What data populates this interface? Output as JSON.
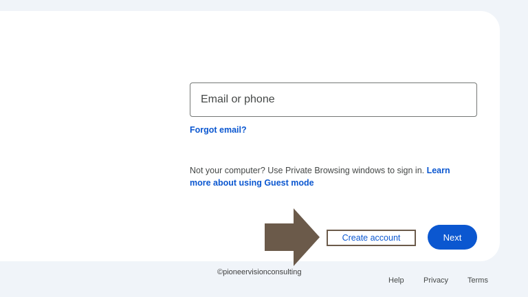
{
  "signin": {
    "email_placeholder": "Email or phone",
    "forgot_email_label": "Forgot email?",
    "guest_notice_text": "Not your computer? Use Private Browsing windows to sign in. ",
    "guest_link_label": "Learn more about using Guest mode",
    "create_account_label": "Create account",
    "next_label": "Next"
  },
  "overlay": {
    "arrow_icon": "right-arrow-icon",
    "arrow_color": "#6b5a4a",
    "watermark": "©pioneervisionconsulting"
  },
  "footer": {
    "help_label": "Help",
    "privacy_label": "Privacy",
    "terms_label": "Terms"
  },
  "colors": {
    "page_background": "#f0f4f9",
    "card_background": "#ffffff",
    "accent": "#0b57d0"
  }
}
